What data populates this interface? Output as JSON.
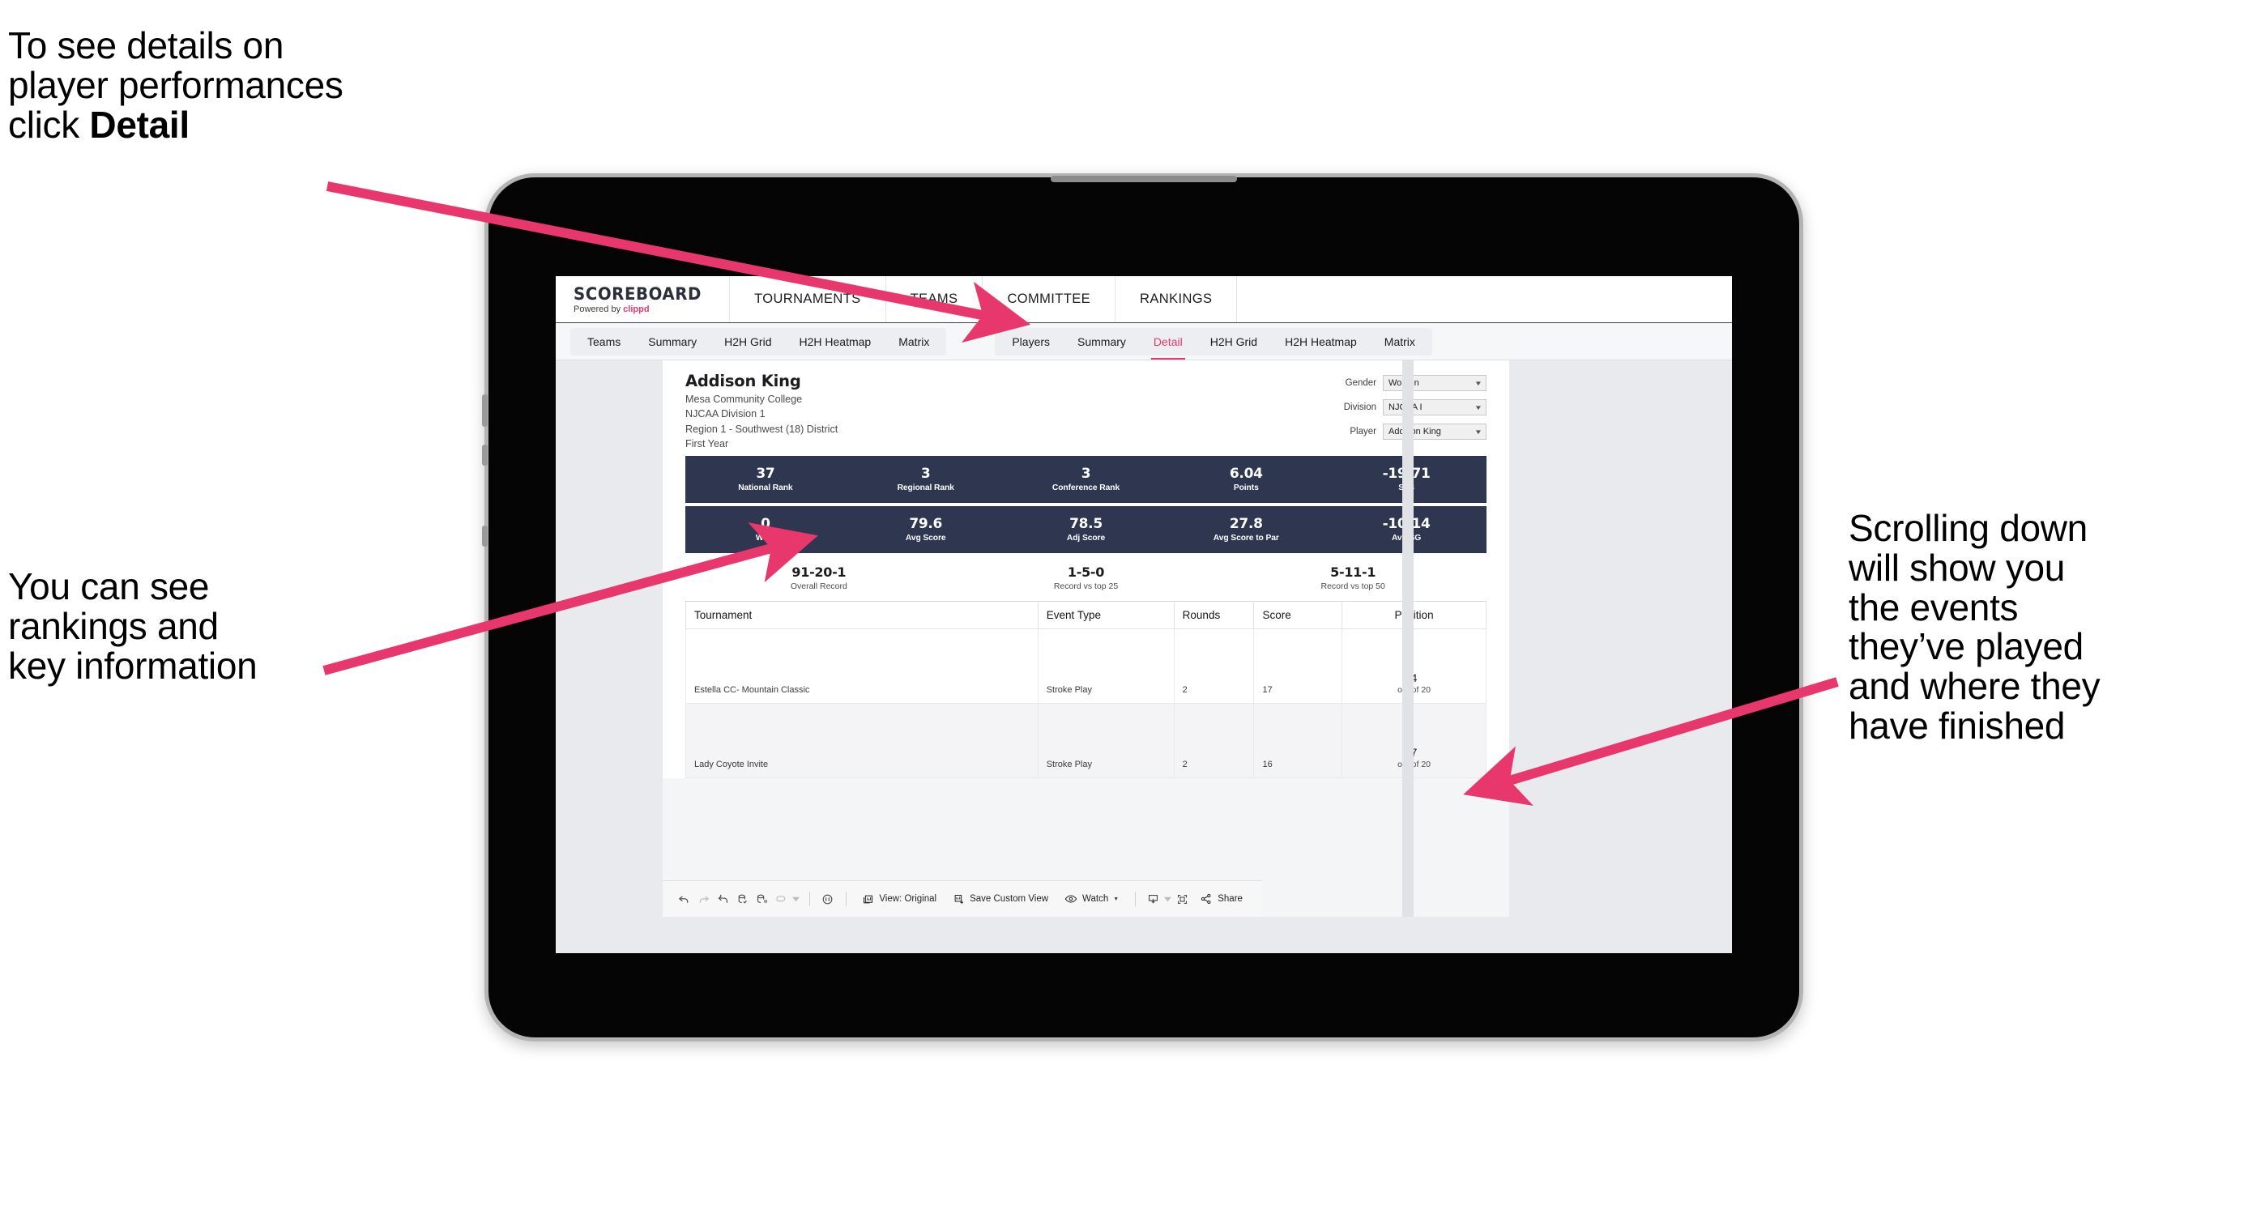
{
  "annotations": {
    "detail": "To see details on\nplayer performances\nclick ",
    "detail_bold": "Detail",
    "rankings": "You can see\nrankings and\nkey information",
    "scrolling": "Scrolling down\nwill show you\nthe events\nthey’ve played\nand where they\nhave finished"
  },
  "app": {
    "brand": {
      "title": "SCOREBOARD",
      "powered_prefix": "Powered by ",
      "powered_brand": "clippd"
    },
    "topnav": [
      "TOURNAMENTS",
      "TEAMS",
      "COMMITTEE",
      "RANKINGS"
    ],
    "tabs_team": [
      "Teams",
      "Summary",
      "H2H Grid",
      "H2H Heatmap",
      "Matrix"
    ],
    "tabs_player": [
      "Players",
      "Summary",
      "Detail",
      "H2H Grid",
      "H2H Heatmap",
      "Matrix"
    ],
    "active_tab": "Detail"
  },
  "player": {
    "name": "Addison King",
    "school": "Mesa Community College",
    "division": "NJCAA Division 1",
    "region": "Region 1 - Southwest (18) District",
    "year": "First Year"
  },
  "filters": [
    {
      "label": "Gender",
      "value": "Women"
    },
    {
      "label": "Division",
      "value": "NJCAA I"
    },
    {
      "label": "Player",
      "value": "Addison King"
    }
  ],
  "stats_band_1": [
    {
      "value": "37",
      "label": "National Rank"
    },
    {
      "value": "3",
      "label": "Regional Rank"
    },
    {
      "value": "3",
      "label": "Conference Rank"
    },
    {
      "value": "6.04",
      "label": "Points"
    },
    {
      "value": "-19.71",
      "label": "SoS"
    }
  ],
  "stats_band_2": [
    {
      "value": "0",
      "label": "Wins"
    },
    {
      "value": "79.6",
      "label": "Avg Score"
    },
    {
      "value": "78.5",
      "label": "Adj Score"
    },
    {
      "value": "27.8",
      "label": "Avg Score to Par"
    },
    {
      "value": "-10.14",
      "label": "Avg SG"
    }
  ],
  "records": [
    {
      "value": "91-20-1",
      "label": "Overall Record"
    },
    {
      "value": "1-5-0",
      "label": "Record vs top 25"
    },
    {
      "value": "5-11-1",
      "label": "Record vs top 50"
    }
  ],
  "events_table": {
    "headers": [
      "Tournament",
      "Event Type",
      "Rounds",
      "Score",
      "Position"
    ],
    "rows": [
      {
        "tournament": "Estella CC- Mountain Classic",
        "event_type": "Stroke Play",
        "rounds": "2",
        "score": "17",
        "position_num": "4",
        "position_out": "out of 20"
      },
      {
        "tournament": "Lady Coyote Invite",
        "event_type": "Stroke Play",
        "rounds": "2",
        "score": "16",
        "position_num": "7",
        "position_out": "out of 20"
      }
    ]
  },
  "toolbar": {
    "view_label": "View: Original",
    "save_label": "Save Custom View",
    "watch_label": "Watch",
    "share_label": "Share"
  },
  "colors": {
    "accent_pink": "#e8376c",
    "band_navy": "#2e3650",
    "canvas": "#e8eaed"
  }
}
